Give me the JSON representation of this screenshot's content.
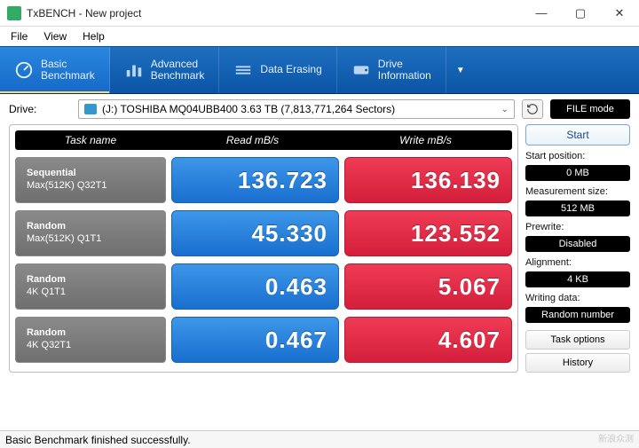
{
  "window": {
    "title": "TxBENCH - New project",
    "min": "—",
    "max": "▢",
    "close": "✕"
  },
  "menu": {
    "file": "File",
    "view": "View",
    "help": "Help"
  },
  "tabs": {
    "basic": "Basic\nBenchmark",
    "advanced": "Advanced\nBenchmark",
    "erase": "Data Erasing",
    "info": "Drive\nInformation"
  },
  "drive": {
    "label": "Drive:",
    "selected": "(J:) TOSHIBA MQ04UBB400  3.63 TB (7,813,771,264 Sectors)",
    "file_mode": "FILE mode"
  },
  "headers": {
    "task": "Task name",
    "read": "Read mB/s",
    "write": "Write mB/s"
  },
  "rows": [
    {
      "line1": "Sequential",
      "line2": "Max(512K) Q32T1",
      "read": "136.723",
      "write": "136.139"
    },
    {
      "line1": "Random",
      "line2": "Max(512K) Q1T1",
      "read": "45.330",
      "write": "123.552"
    },
    {
      "line1": "Random",
      "line2": "4K Q1T1",
      "read": "0.463",
      "write": "5.067"
    },
    {
      "line1": "Random",
      "line2": "4K Q32T1",
      "read": "0.467",
      "write": "4.607"
    }
  ],
  "side": {
    "start": "Start",
    "start_pos_label": "Start position:",
    "start_pos": "0 MB",
    "meas_label": "Measurement size:",
    "meas": "512 MB",
    "prewrite_label": "Prewrite:",
    "prewrite": "Disabled",
    "align_label": "Alignment:",
    "align": "4 KB",
    "writing_label": "Writing data:",
    "writing": "Random number",
    "task_options": "Task options",
    "history": "History"
  },
  "status": "Basic Benchmark finished successfully.",
  "watermark": "新浪众测",
  "chart_data": {
    "type": "table",
    "title": "TxBENCH Basic Benchmark",
    "columns": [
      "Task name",
      "Read mB/s",
      "Write mB/s"
    ],
    "rows": [
      [
        "Sequential Max(512K) Q32T1",
        136.723,
        136.139
      ],
      [
        "Random Max(512K) Q1T1",
        45.33,
        123.552
      ],
      [
        "Random 4K Q1T1",
        0.463,
        5.067
      ],
      [
        "Random 4K Q32T1",
        0.467,
        4.607
      ]
    ]
  }
}
